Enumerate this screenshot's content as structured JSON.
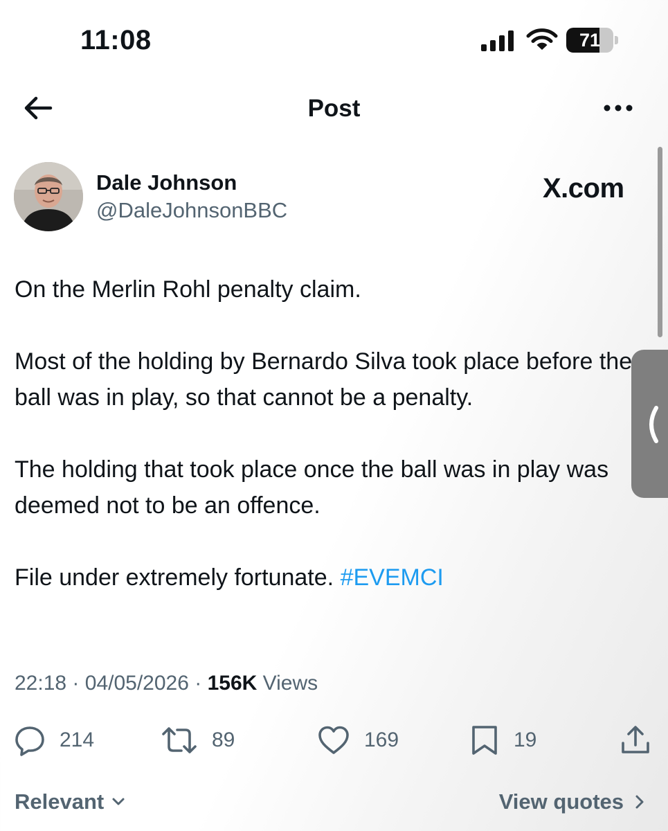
{
  "status_bar": {
    "time": "11:08",
    "battery_level": "71",
    "battery_percent": 71,
    "icons": [
      "cellular-signal-icon",
      "wifi-icon",
      "battery-icon"
    ]
  },
  "nav": {
    "title": "Post",
    "back_icon": "arrow-left-icon",
    "more_icon": "ellipsis-icon"
  },
  "post": {
    "author_name": "Dale Johnson",
    "author_handle": "@DaleJohnsonBBC",
    "watermark": "X.com",
    "paragraphs": [
      "On the Merlin Rohl penalty claim.",
      "Most of the holding by Bernardo Silva took place before the ball was in play, so that cannot be a penalty.",
      "The holding that took place once the ball was in play was deemed not to be an offence."
    ],
    "last_line_text": "File under extremely fortunate. ",
    "hashtag": "#EVEMCI",
    "time": "22:18",
    "dot": "·",
    "date": "04/05/2026",
    "views_count": "156K",
    "views_label": "Views"
  },
  "actions": {
    "replies": "214",
    "reposts": "89",
    "likes": "169",
    "bookmarks": "19"
  },
  "footer": {
    "sort_label": "Relevant",
    "quotes_label": "View quotes"
  },
  "colors": {
    "text": "#0f1419",
    "secondary": "#536471",
    "accent": "#1d9bf0"
  }
}
